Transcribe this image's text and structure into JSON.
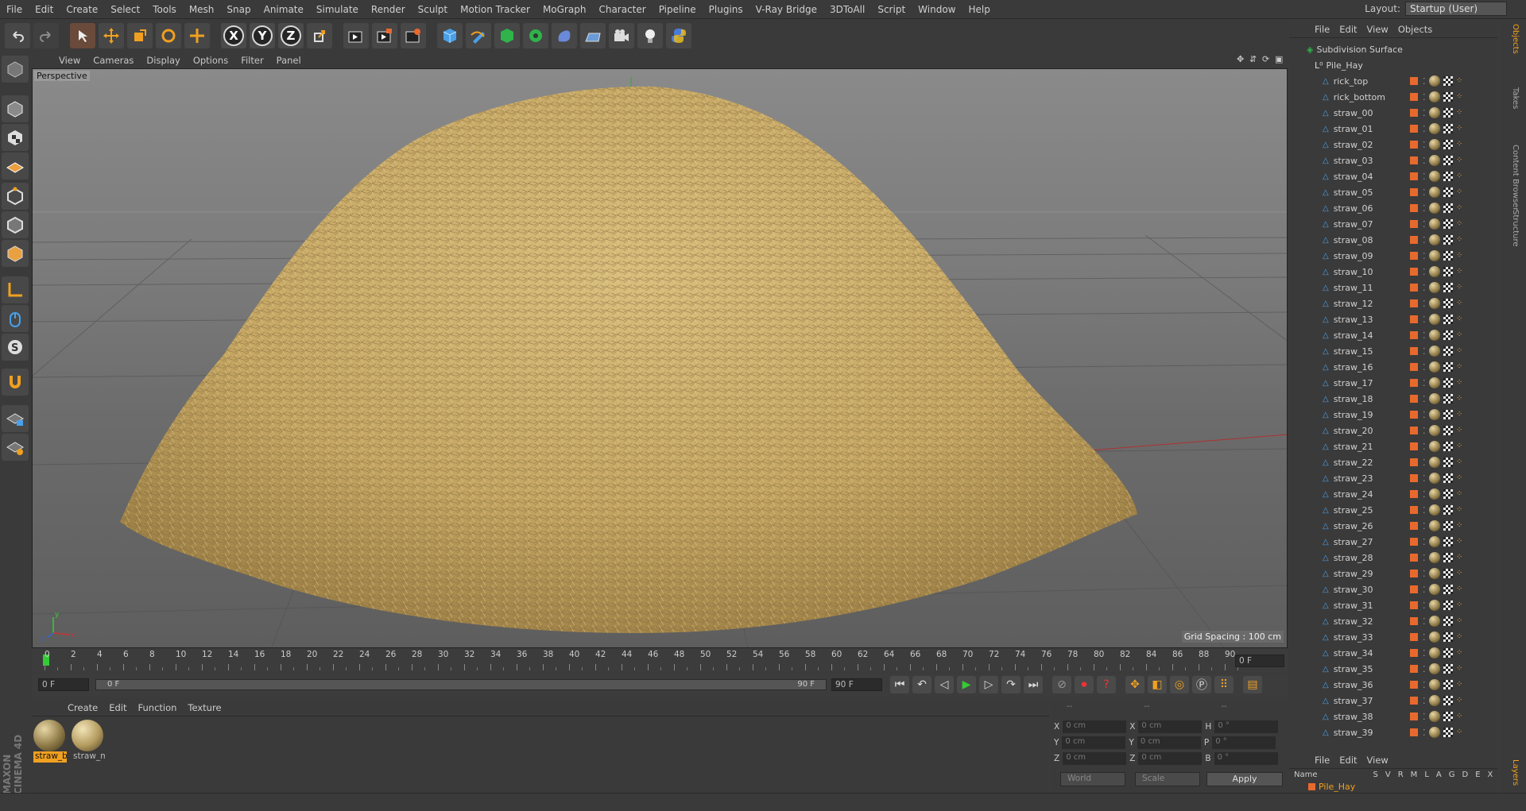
{
  "menubar": [
    "File",
    "Edit",
    "Create",
    "Select",
    "Tools",
    "Mesh",
    "Snap",
    "Animate",
    "Simulate",
    "Render",
    "Sculpt",
    "Motion Tracker",
    "MoGraph",
    "Character",
    "Pipeline",
    "Plugins",
    "V-Ray Bridge",
    "3DToAll",
    "Script",
    "Window",
    "Help"
  ],
  "layout": {
    "label": "Layout:",
    "value": "Startup (User)"
  },
  "toolbar": {
    "axis_x": "X",
    "axis_y": "Y",
    "axis_z": "Z"
  },
  "viewport": {
    "menu": [
      "View",
      "Cameras",
      "Display",
      "Options",
      "Filter",
      "Panel"
    ],
    "label": "Perspective",
    "grid_spacing": "Grid Spacing : 100 cm"
  },
  "timeline": {
    "ticks": [
      "0",
      "2",
      "4",
      "6",
      "8",
      "10",
      "12",
      "14",
      "16",
      "18",
      "20",
      "22",
      "24",
      "26",
      "28",
      "30",
      "32",
      "34",
      "36",
      "38",
      "40",
      "42",
      "44",
      "46",
      "48",
      "50",
      "52",
      "54",
      "56",
      "58",
      "60",
      "62",
      "64",
      "66",
      "68",
      "70",
      "72",
      "74",
      "76",
      "78",
      "80",
      "82",
      "84",
      "86",
      "88",
      "90"
    ],
    "current_frame": "0 F",
    "start_field": "0 F",
    "range_start": "0 F",
    "range_end": "90 F",
    "end_field": "90 F"
  },
  "materials": {
    "menu": [
      "Create",
      "Edit",
      "Function",
      "Texture"
    ],
    "items": [
      {
        "name": "straw_b"
      },
      {
        "name": "straw_m"
      }
    ]
  },
  "coords": {
    "header": [
      "--",
      "--",
      "--"
    ],
    "rows": [
      {
        "a": "X",
        "av": "0 cm",
        "b": "X",
        "bv": "0 cm",
        "c": "H",
        "cv": "0 °"
      },
      {
        "a": "Y",
        "av": "0 cm",
        "b": "Y",
        "bv": "0 cm",
        "c": "P",
        "cv": "0 °"
      },
      {
        "a": "Z",
        "av": "0 cm",
        "b": "Z",
        "bv": "0 cm",
        "c": "B",
        "cv": "0 °"
      }
    ],
    "world": "World",
    "scale": "Scale",
    "apply": "Apply"
  },
  "objects": {
    "menu": [
      "File",
      "Edit",
      "View",
      "Objects"
    ],
    "root": "Subdivision Surface",
    "group": "Pile_Hay",
    "items": [
      "rick_top",
      "rick_bottom",
      "straw_00",
      "straw_01",
      "straw_02",
      "straw_03",
      "straw_04",
      "straw_05",
      "straw_06",
      "straw_07",
      "straw_08",
      "straw_09",
      "straw_10",
      "straw_11",
      "straw_12",
      "straw_13",
      "straw_14",
      "straw_15",
      "straw_16",
      "straw_17",
      "straw_18",
      "straw_19",
      "straw_20",
      "straw_21",
      "straw_22",
      "straw_23",
      "straw_24",
      "straw_25",
      "straw_26",
      "straw_27",
      "straw_28",
      "straw_29",
      "straw_30",
      "straw_31",
      "straw_32",
      "straw_33",
      "straw_34",
      "straw_35",
      "straw_36",
      "straw_37",
      "straw_38",
      "straw_39"
    ]
  },
  "side_tabs": [
    "Objects",
    "Takes",
    "Content Browser",
    "Structure"
  ],
  "layers": {
    "menu": [
      "File",
      "Edit",
      "View"
    ],
    "header": [
      "Name",
      "S",
      "V",
      "R",
      "M",
      "L",
      "A",
      "G",
      "D",
      "E",
      "X"
    ],
    "item": "Pile_Hay",
    "tab": "Layers"
  },
  "logo": "MAXON CINEMA 4D",
  "colors": {
    "accent": "#e8692e",
    "hay": "#c9a963",
    "panel": "#3a3a3a"
  }
}
